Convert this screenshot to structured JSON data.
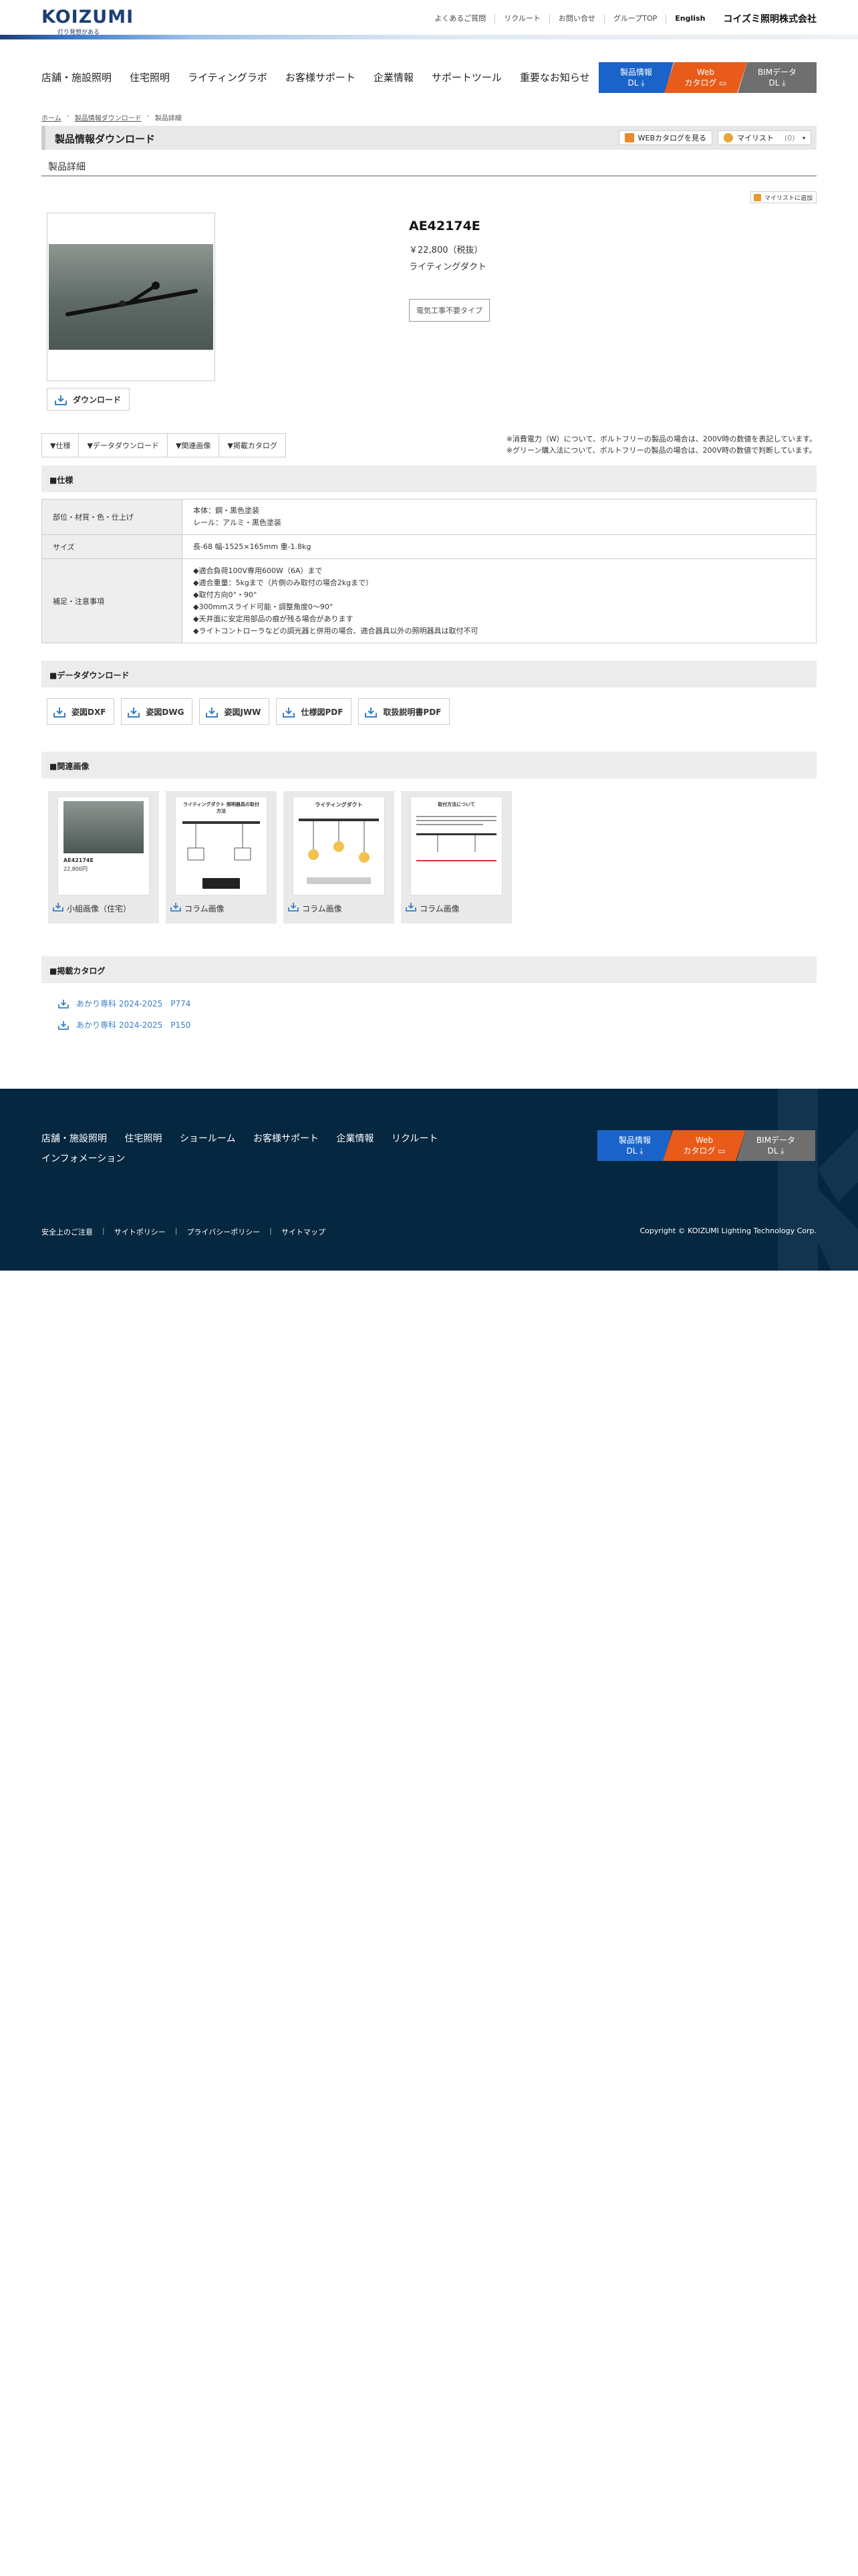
{
  "header": {
    "logo": "KOIZUMI",
    "tagline": "灯り発想がある",
    "links": [
      "よくあるご質問",
      "リクルート",
      "お問い合せ",
      "グループTOP"
    ],
    "english": "English",
    "corp": "コイズミ照明株式会社"
  },
  "gnav": {
    "items": [
      "店舗・施設照明",
      "住宅照明",
      "ライティングラボ",
      "お客様サポート",
      "企業情報",
      "サポートツール",
      "重要なお知らせ"
    ],
    "btn1": [
      "製品情報",
      "DL"
    ],
    "btn2": [
      "Web",
      "カタログ"
    ],
    "btn3": [
      "BIMデータ",
      "DL"
    ]
  },
  "breadcrumb": [
    "ホーム",
    "製品情報ダウンロード",
    "製品詳細"
  ],
  "title": {
    "main": "製品情報ダウンロード",
    "web_catalog": "WEBカタログを見る",
    "mylist": "マイリスト",
    "mylist_count": "(0)",
    "sub": "製品詳細",
    "add_mylist": "マイリストに追加"
  },
  "product": {
    "code": "AE42174E",
    "price": "￥22,800（税抜）",
    "category": "ライティングダクト",
    "tag": "電気工事不要タイプ",
    "download": "ダウンロード"
  },
  "anchors": [
    "▼仕様",
    "▼データダウンロード",
    "▼関連画像",
    "▼掲載カタログ"
  ],
  "notes": [
    "※消費電力（W）について、ボルトフリーの製品の場合は、200V時の数値を表記しています。",
    "※グリーン購入法について、ボルトフリーの製品の場合は、200V時の数値で判断しています。"
  ],
  "sections": {
    "spec": "■仕様",
    "data_dl": "■データダウンロード",
    "related": "■関連画像",
    "catalog": "■掲載カタログ"
  },
  "spec": {
    "row1_label": "部位・材質・色・仕上げ",
    "row1_value": [
      "本体：鋼・黒色塗装",
      "レール：アルミ・黒色塗装"
    ],
    "row2_label": "サイズ",
    "row2_value": "長-68 幅-1525×165mm 重-1.8kg",
    "row3_label": "補足・注意事項",
    "row3_value": [
      "◆適合負荷100V専用600W（6A）まで",
      "◆適合重量：5kgまで（片側のみ取付の場合2kgまで）",
      "◆取付方向0°・90°",
      "◆300mmスライド可能・調整角度0〜90°",
      "◆天井面に安定用部品の痕が残る場合があります",
      "◆ライトコントローラなどの調光器と併用の場合、適合器具以外の照明器具は取付不可"
    ]
  },
  "data_downloads": [
    "姿図DXF",
    "姿図DWG",
    "姿図JWW",
    "仕様図PDF",
    "取扱説明書PDF"
  ],
  "related_images": [
    {
      "label": "小組画像（住宅）",
      "thumb_title": "AE42174E",
      "thumb_price": "22,800円"
    },
    {
      "label": "コラム画像",
      "thumb_title": "ライティングダクト 照明器具の取付方法",
      "thumb_price": ""
    },
    {
      "label": "コラム画像",
      "thumb_title": "ライティングダクト",
      "thumb_price": ""
    },
    {
      "label": "コラム画像",
      "thumb_title": "取付方法について",
      "thumb_price": ""
    }
  ],
  "catalogs": [
    "あかり専科 2024-2025　P774",
    "あかり専科 2024-2025　P150"
  ],
  "footer": {
    "nav": [
      "店舗・施設照明",
      "住宅照明",
      "ショールーム",
      "お客様サポート",
      "企業情報",
      "リクルート",
      "インフォメーション"
    ],
    "sub": [
      "安全上のご注意",
      "サイトポリシー",
      "プライバシーポリシー",
      "サイトマップ"
    ],
    "copyright": "Copyright © KOIZUMI Lighting Technology Corp."
  },
  "colors": {
    "navy": "#062740",
    "blue": "#1a63c9",
    "orange": "#e85b1a",
    "gray": "#6f6f6f",
    "link": "#3a7fc4"
  }
}
